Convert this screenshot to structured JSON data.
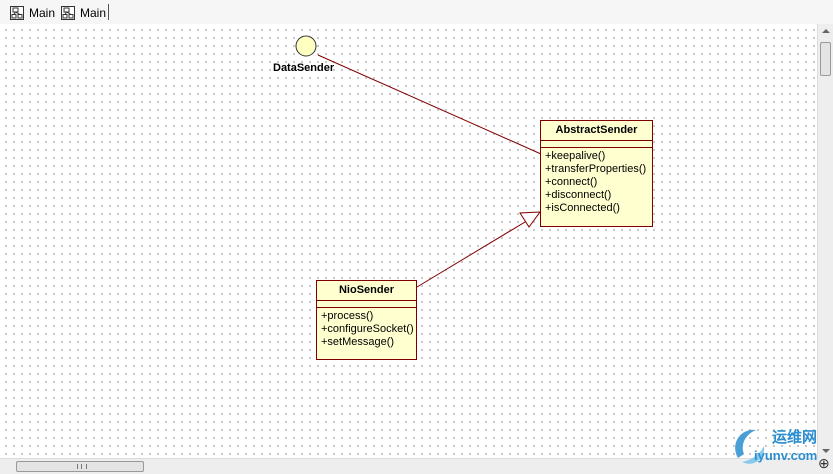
{
  "tabs": [
    {
      "label": "Main",
      "icon": "class-diagram-icon"
    },
    {
      "label": "Main",
      "icon": "class-diagram-icon"
    }
  ],
  "diagram": {
    "interface": {
      "name": "DataSender"
    },
    "classes": [
      {
        "name": "AbstractSender",
        "operations": [
          "+keepalive()",
          "+transferProperties()",
          "+connect()",
          "+disconnect()",
          "+isConnected()"
        ]
      },
      {
        "name": "NioSender",
        "operations": [
          "+process()",
          "+configureSocket()",
          "+setMessage()"
        ]
      }
    ],
    "relations": [
      {
        "from": "AbstractSender",
        "to": "DataSender",
        "type": "realization"
      },
      {
        "from": "NioSender",
        "to": "AbstractSender",
        "type": "generalization"
      }
    ]
  },
  "watermark": {
    "cn": "运维网",
    "en": "iyunv.com"
  },
  "colors": {
    "class_fill": "#ffffd0",
    "class_border": "#800000",
    "interface_fill": "#ffffc0",
    "watermark": "#2a8ed0"
  },
  "scroll_cursor": "⊕"
}
